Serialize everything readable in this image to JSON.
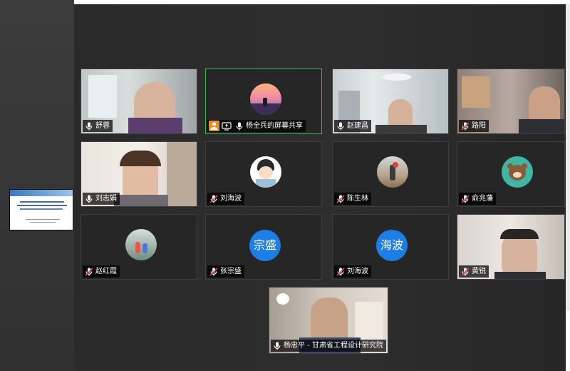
{
  "colors": {
    "muted_mic": "#e24a4a",
    "active_speaker_border": "#35b35a",
    "text_avatar_bg": "#1d7fe6",
    "share_icon_bg": "#f08a1c"
  },
  "participants": [
    {
      "name": "舒蓉",
      "mic": "on",
      "view": "video"
    },
    {
      "name": "杨全兵的屏幕共享",
      "mic": "on",
      "view": "avatar",
      "active": true,
      "icons": [
        "share-screen-icon",
        "screen-share-badge-icon"
      ]
    },
    {
      "name": "赵建昌",
      "mic": "on",
      "view": "video"
    },
    {
      "name": "路阳",
      "mic": "muted",
      "view": "video"
    },
    {
      "name": "刘志娟",
      "mic": "on",
      "view": "video"
    },
    {
      "name": "刘海波",
      "mic": "muted",
      "view": "avatar"
    },
    {
      "name": "陈生林",
      "mic": "muted",
      "view": "avatar"
    },
    {
      "name": "俞兆藩",
      "mic": "muted",
      "view": "avatar"
    },
    {
      "name": "赵红霞",
      "mic": "muted",
      "view": "avatar"
    },
    {
      "name": "张宗盛",
      "mic": "muted",
      "view": "text-avatar",
      "avatar_text": "宗盛"
    },
    {
      "name": "刘海波",
      "mic": "muted",
      "view": "text-avatar",
      "avatar_text": "海波"
    },
    {
      "name": "黄锐",
      "mic": "muted",
      "view": "video"
    },
    {
      "name": "杨忠平 - 甘肃省工程设计研究院",
      "mic": "on",
      "view": "video"
    }
  ]
}
